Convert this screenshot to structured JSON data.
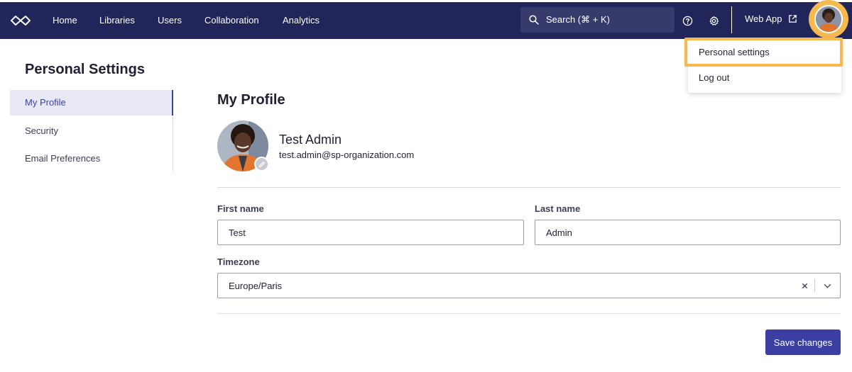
{
  "nav": {
    "logo_icon": "infinity-logo-icon",
    "links": [
      "Home",
      "Libraries",
      "Users",
      "Collaboration",
      "Analytics"
    ],
    "search_label": "Search (⌘ + K)",
    "help_icon": "help-circle-icon",
    "settings_icon": "gear-icon",
    "web_app_label": "Web App",
    "external_icon": "external-link-icon",
    "bar_color": "#212559",
    "highlight_color": "#f6b94f"
  },
  "user_menu": {
    "items": [
      "Personal settings",
      "Log out"
    ]
  },
  "sidebar": {
    "title": "Personal Settings",
    "items": [
      "My Profile",
      "Security",
      "Email Preferences"
    ],
    "active": "My Profile"
  },
  "profile": {
    "section_title": "My Profile",
    "name": "Test Admin",
    "email": "test.admin@sp-organization.com",
    "edit_icon": "pencil-icon"
  },
  "form": {
    "first_name_label": "First name",
    "first_name_value": "Test",
    "last_name_label": "Last name",
    "last_name_value": "Admin",
    "timezone_label": "Timezone",
    "timezone_value": "Europe/Paris",
    "save_label": "Save changes",
    "accent_color": "#3c3fa2"
  }
}
